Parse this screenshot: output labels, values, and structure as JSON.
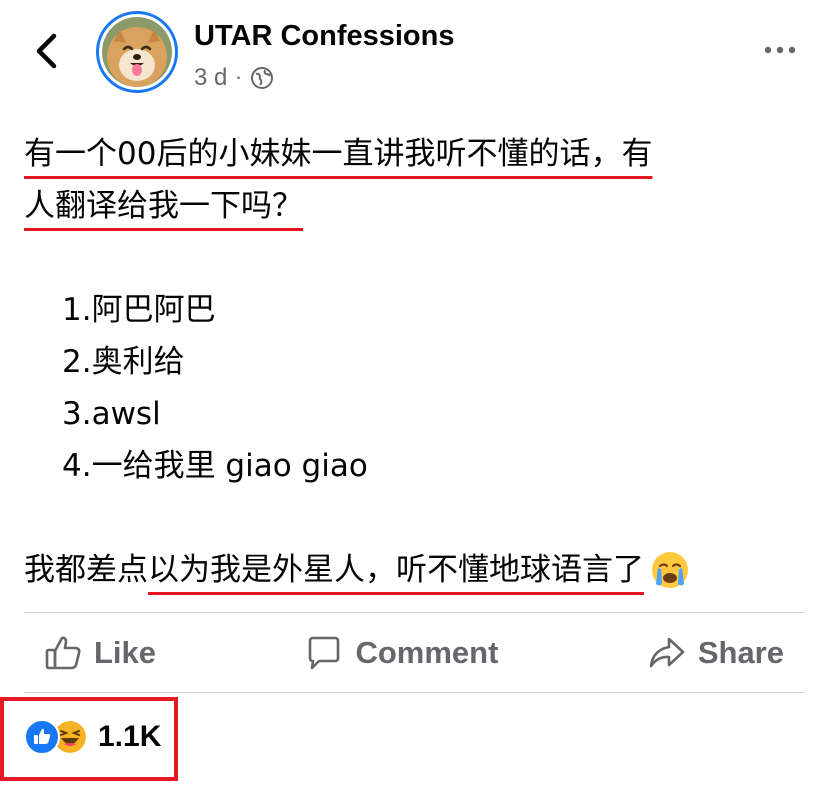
{
  "header": {
    "page_name": "UTAR Confessions",
    "time": "3 d",
    "separator": "·"
  },
  "post": {
    "line1": "有一个00后的小妹妹一直讲我听不懂的话，有",
    "line2": "人翻译给我一下吗？",
    "list": [
      "1.阿巴阿巴",
      "2.奥利给",
      "3.awsl",
      "4.一给我里 giao giao"
    ],
    "final_plain": "我都差点",
    "final_underlined": "以为我是外星人，听不懂地球语言了"
  },
  "actions": {
    "like": "Like",
    "comment": "Comment",
    "share": "Share"
  },
  "reactions": {
    "count": "1.1K"
  },
  "colors": {
    "accent": "#1877f2",
    "underline": "#e4161f",
    "highlight_box": "#e41b23",
    "secondary_text": "#65676b"
  }
}
